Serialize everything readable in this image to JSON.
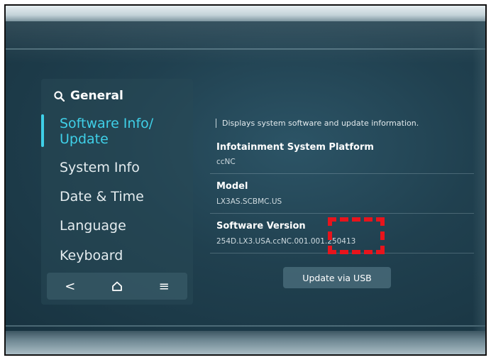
{
  "sidebar": {
    "header": "General",
    "items": [
      {
        "label": "Software Info/\nUpdate",
        "active": true
      },
      {
        "label": "System Info",
        "active": false
      },
      {
        "label": "Date & Time",
        "active": false
      },
      {
        "label": "Language",
        "active": false
      },
      {
        "label": "Keyboard",
        "active": false
      }
    ],
    "nav": {
      "back": "<",
      "home": "⌂",
      "menu": "≡"
    }
  },
  "main": {
    "description": "Displays system software and update information.",
    "platform_title": "Infotainment System Platform",
    "platform_value": "ccNC",
    "model_title": "Model",
    "model_value": "LX3AS.SCBMC.US",
    "software_title": "Software Version",
    "software_value": "254D.LX3.USA.ccNC.001.001.250413",
    "update_button": "Update via USB"
  },
  "colors": {
    "accent": "#3fd0e8",
    "highlight": "#e8141c",
    "background": "#1f3a47"
  }
}
